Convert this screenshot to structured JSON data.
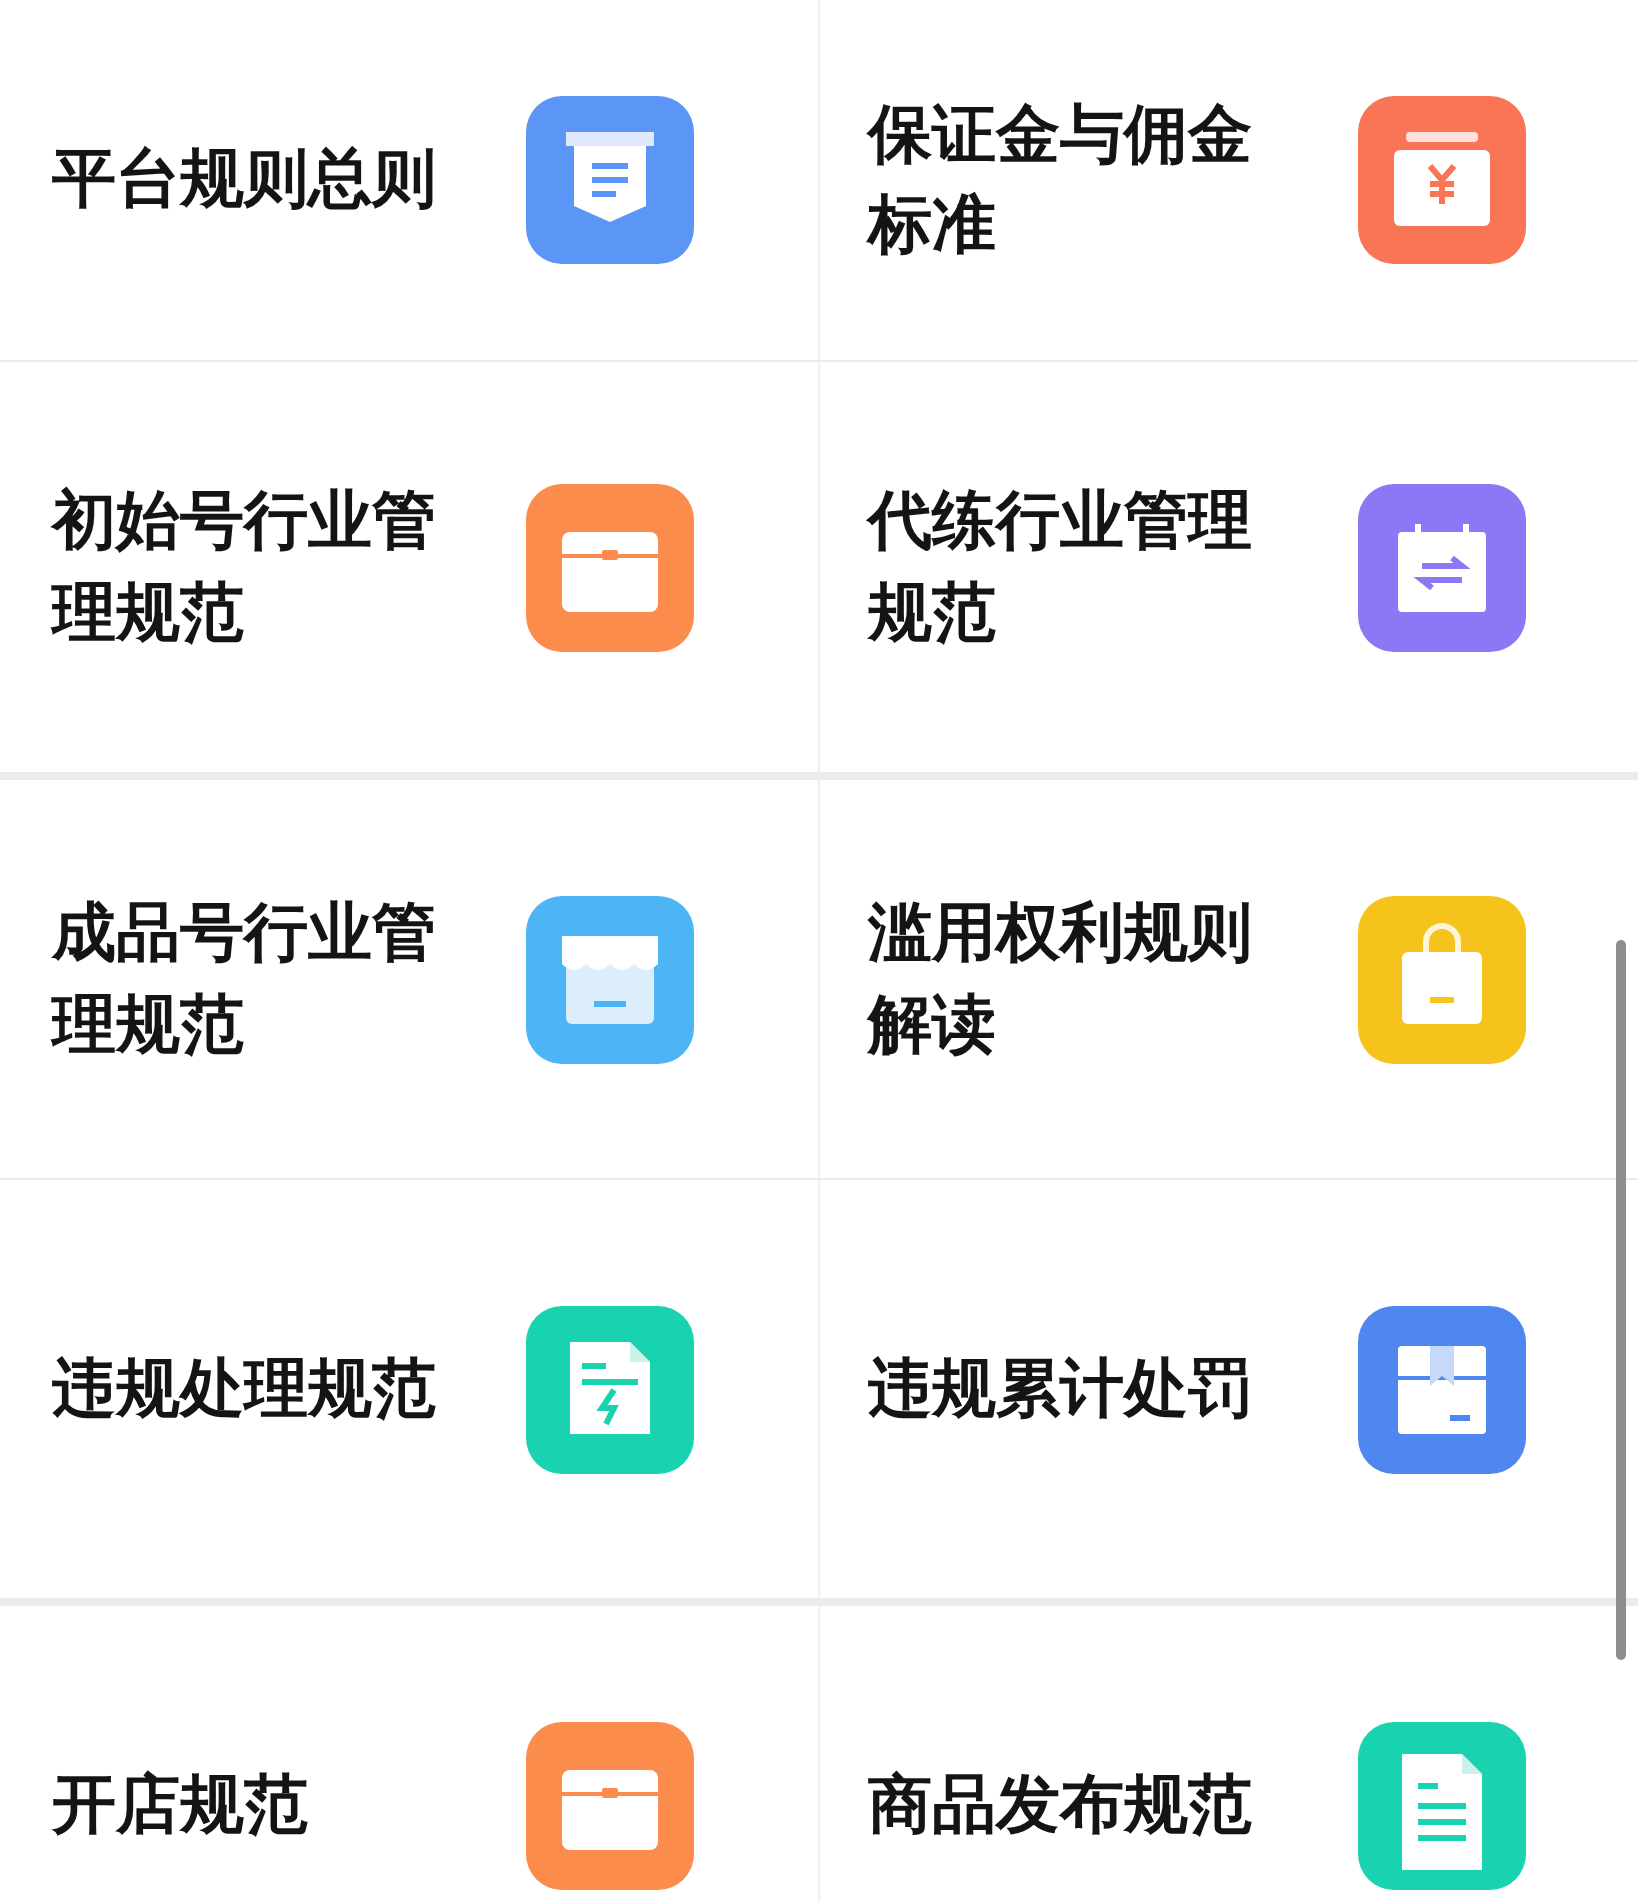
{
  "rows": [
    {
      "items": [
        {
          "title": "平台规则总则",
          "kind": "notice",
          "color": "#5b95f5"
        },
        {
          "title": "保证金与佣金标准",
          "kind": "wallet",
          "color": "#fa7555"
        }
      ]
    },
    {
      "items": [
        {
          "title": "初始号行业管理规范",
          "kind": "toolbox",
          "color": "#fb8c4c"
        },
        {
          "title": "代练行业管理规范",
          "kind": "swap",
          "color": "#8a78f5"
        }
      ]
    },
    {
      "items": [
        {
          "title": "成品号行业管理规范",
          "kind": "store",
          "color": "#4db5f5"
        },
        {
          "title": "滥用权利规则解读",
          "kind": "bag",
          "color": "#f6c31c"
        }
      ]
    },
    {
      "items": [
        {
          "title": "违规处理规范",
          "kind": "bolt",
          "color": "#19d3b0"
        },
        {
          "title": "违规累计处罚",
          "kind": "box",
          "color": "#4f86f0"
        }
      ]
    },
    {
      "items": [
        {
          "title": "开店规范",
          "kind": "toolbox",
          "color": "#fb8c4c"
        },
        {
          "title": "商品发布规范",
          "kind": "doc",
          "color": "#19d3b0"
        }
      ]
    }
  ]
}
